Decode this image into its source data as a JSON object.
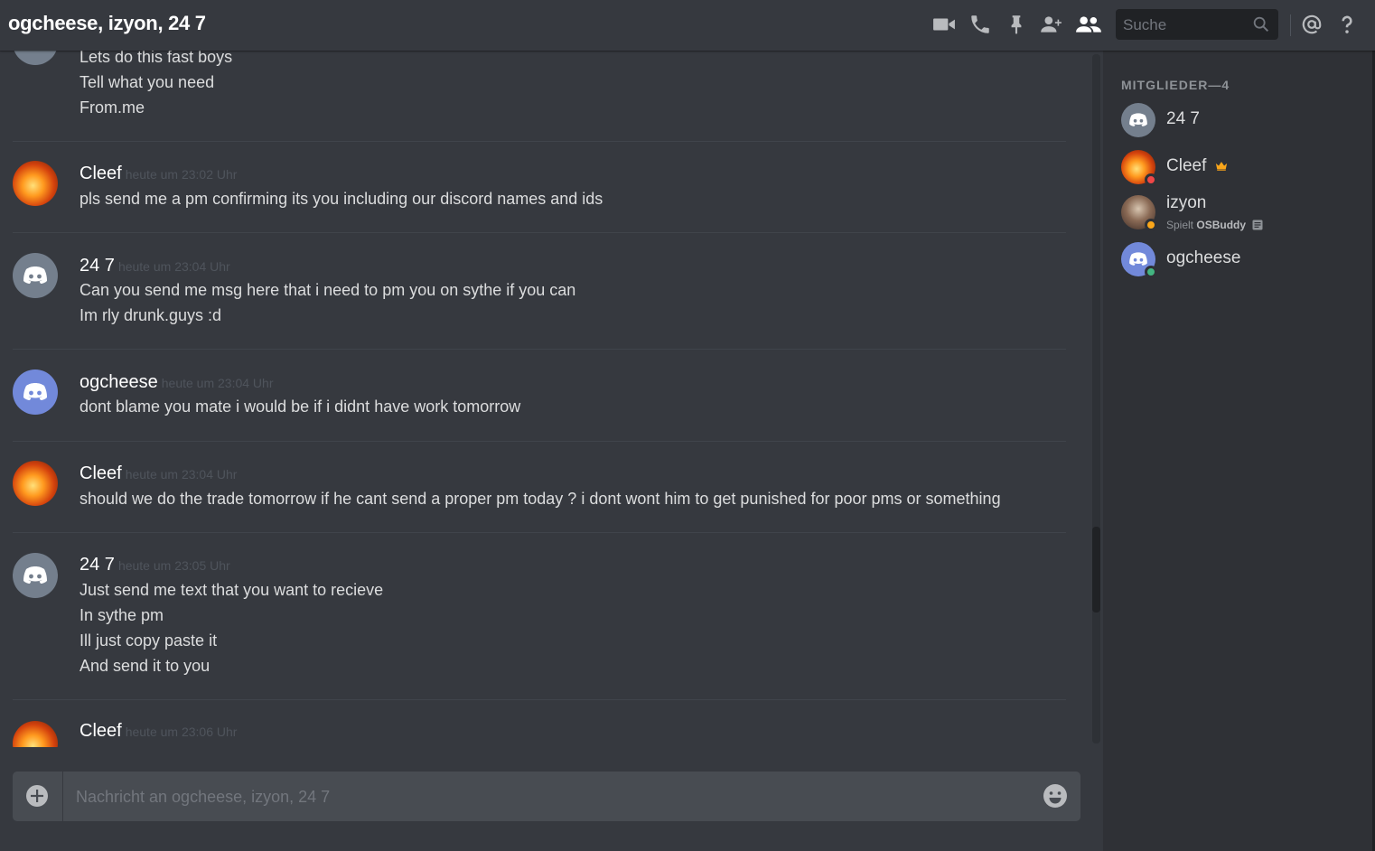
{
  "header": {
    "title": "ogcheese, izyon, 24 7",
    "search_placeholder": "Suche",
    "icons": [
      "video-call-icon",
      "voice-call-icon",
      "pin-icon",
      "add-friend-icon",
      "member-list-icon",
      "search-icon",
      "mention-icon",
      "help-icon"
    ]
  },
  "messages": [
    {
      "author": "",
      "time": "",
      "lines": [
        "Lets do this fast boys",
        "Tell what you need",
        "From.me"
      ]
    },
    {
      "author": "Cleef",
      "time": "heute um 23:02 Uhr",
      "lines": [
        "pls send me a pm confirming its you including our discord names and ids"
      ]
    },
    {
      "author": "24 7",
      "time": "heute um 23:04 Uhr",
      "lines": [
        "Can you send me msg here that i need to pm you on sythe if you can",
        "Im rly drunk.guys :d"
      ]
    },
    {
      "author": "ogcheese",
      "time": "heute um 23:04 Uhr",
      "lines": [
        "dont blame you mate i would be if i didnt have work tomorrow"
      ]
    },
    {
      "author": "Cleef",
      "time": "heute um 23:04 Uhr",
      "lines": [
        "should we do the trade tomorrow if he cant send a proper pm today ? i dont wont him to get punished for poor pms or something"
      ]
    },
    {
      "author": "24 7",
      "time": "heute um 23:05 Uhr",
      "lines": [
        "Just send me text that you want to recieve",
        "In sythe pm",
        "Ill just copy paste it",
        "And send it to you"
      ]
    },
    {
      "author": "Cleef",
      "time": "heute um 23:06 Uhr",
      "lines": []
    }
  ],
  "composer": {
    "placeholder": "Nachricht an ogcheese, izyon, 24 7"
  },
  "members": {
    "header": "MITGLIEDER—4",
    "list": [
      {
        "name": "24 7",
        "status": "",
        "activity_prefix": "",
        "activity_name": ""
      },
      {
        "name": "Cleef",
        "status": "dnd",
        "owner": true,
        "activity_prefix": "",
        "activity_name": ""
      },
      {
        "name": "izyon",
        "status": "idle",
        "activity_prefix": "Spielt",
        "activity_name": "OSBuddy"
      },
      {
        "name": "ogcheese",
        "status": "online",
        "activity_prefix": "",
        "activity_name": ""
      }
    ]
  },
  "colors": {
    "background": "#36393f",
    "sidebar": "#2f3136",
    "blurple": "#7289da",
    "dnd": "#f04747",
    "idle": "#faa61a",
    "online": "#43b581",
    "owner_crown": "#faa61a"
  }
}
